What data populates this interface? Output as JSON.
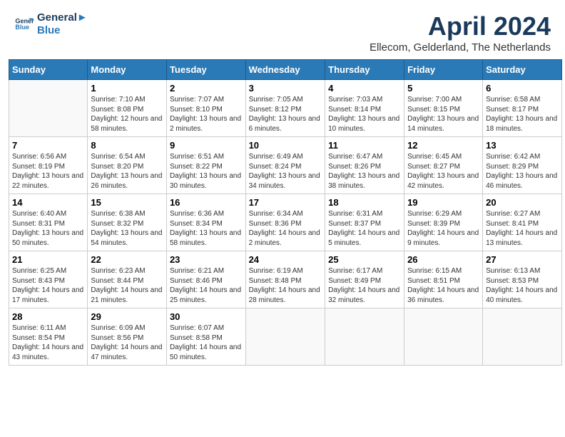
{
  "header": {
    "logo_line1": "General",
    "logo_line2": "Blue",
    "month_year": "April 2024",
    "location": "Ellecom, Gelderland, The Netherlands"
  },
  "days_of_week": [
    "Sunday",
    "Monday",
    "Tuesday",
    "Wednesday",
    "Thursday",
    "Friday",
    "Saturday"
  ],
  "weeks": [
    [
      {
        "day": "",
        "sunrise": "",
        "sunset": "",
        "daylight": ""
      },
      {
        "day": "1",
        "sunrise": "Sunrise: 7:10 AM",
        "sunset": "Sunset: 8:08 PM",
        "daylight": "Daylight: 12 hours and 58 minutes."
      },
      {
        "day": "2",
        "sunrise": "Sunrise: 7:07 AM",
        "sunset": "Sunset: 8:10 PM",
        "daylight": "Daylight: 13 hours and 2 minutes."
      },
      {
        "day": "3",
        "sunrise": "Sunrise: 7:05 AM",
        "sunset": "Sunset: 8:12 PM",
        "daylight": "Daylight: 13 hours and 6 minutes."
      },
      {
        "day": "4",
        "sunrise": "Sunrise: 7:03 AM",
        "sunset": "Sunset: 8:14 PM",
        "daylight": "Daylight: 13 hours and 10 minutes."
      },
      {
        "day": "5",
        "sunrise": "Sunrise: 7:00 AM",
        "sunset": "Sunset: 8:15 PM",
        "daylight": "Daylight: 13 hours and 14 minutes."
      },
      {
        "day": "6",
        "sunrise": "Sunrise: 6:58 AM",
        "sunset": "Sunset: 8:17 PM",
        "daylight": "Daylight: 13 hours and 18 minutes."
      }
    ],
    [
      {
        "day": "7",
        "sunrise": "Sunrise: 6:56 AM",
        "sunset": "Sunset: 8:19 PM",
        "daylight": "Daylight: 13 hours and 22 minutes."
      },
      {
        "day": "8",
        "sunrise": "Sunrise: 6:54 AM",
        "sunset": "Sunset: 8:20 PM",
        "daylight": "Daylight: 13 hours and 26 minutes."
      },
      {
        "day": "9",
        "sunrise": "Sunrise: 6:51 AM",
        "sunset": "Sunset: 8:22 PM",
        "daylight": "Daylight: 13 hours and 30 minutes."
      },
      {
        "day": "10",
        "sunrise": "Sunrise: 6:49 AM",
        "sunset": "Sunset: 8:24 PM",
        "daylight": "Daylight: 13 hours and 34 minutes."
      },
      {
        "day": "11",
        "sunrise": "Sunrise: 6:47 AM",
        "sunset": "Sunset: 8:26 PM",
        "daylight": "Daylight: 13 hours and 38 minutes."
      },
      {
        "day": "12",
        "sunrise": "Sunrise: 6:45 AM",
        "sunset": "Sunset: 8:27 PM",
        "daylight": "Daylight: 13 hours and 42 minutes."
      },
      {
        "day": "13",
        "sunrise": "Sunrise: 6:42 AM",
        "sunset": "Sunset: 8:29 PM",
        "daylight": "Daylight: 13 hours and 46 minutes."
      }
    ],
    [
      {
        "day": "14",
        "sunrise": "Sunrise: 6:40 AM",
        "sunset": "Sunset: 8:31 PM",
        "daylight": "Daylight: 13 hours and 50 minutes."
      },
      {
        "day": "15",
        "sunrise": "Sunrise: 6:38 AM",
        "sunset": "Sunset: 8:32 PM",
        "daylight": "Daylight: 13 hours and 54 minutes."
      },
      {
        "day": "16",
        "sunrise": "Sunrise: 6:36 AM",
        "sunset": "Sunset: 8:34 PM",
        "daylight": "Daylight: 13 hours and 58 minutes."
      },
      {
        "day": "17",
        "sunrise": "Sunrise: 6:34 AM",
        "sunset": "Sunset: 8:36 PM",
        "daylight": "Daylight: 14 hours and 2 minutes."
      },
      {
        "day": "18",
        "sunrise": "Sunrise: 6:31 AM",
        "sunset": "Sunset: 8:37 PM",
        "daylight": "Daylight: 14 hours and 5 minutes."
      },
      {
        "day": "19",
        "sunrise": "Sunrise: 6:29 AM",
        "sunset": "Sunset: 8:39 PM",
        "daylight": "Daylight: 14 hours and 9 minutes."
      },
      {
        "day": "20",
        "sunrise": "Sunrise: 6:27 AM",
        "sunset": "Sunset: 8:41 PM",
        "daylight": "Daylight: 14 hours and 13 minutes."
      }
    ],
    [
      {
        "day": "21",
        "sunrise": "Sunrise: 6:25 AM",
        "sunset": "Sunset: 8:43 PM",
        "daylight": "Daylight: 14 hours and 17 minutes."
      },
      {
        "day": "22",
        "sunrise": "Sunrise: 6:23 AM",
        "sunset": "Sunset: 8:44 PM",
        "daylight": "Daylight: 14 hours and 21 minutes."
      },
      {
        "day": "23",
        "sunrise": "Sunrise: 6:21 AM",
        "sunset": "Sunset: 8:46 PM",
        "daylight": "Daylight: 14 hours and 25 minutes."
      },
      {
        "day": "24",
        "sunrise": "Sunrise: 6:19 AM",
        "sunset": "Sunset: 8:48 PM",
        "daylight": "Daylight: 14 hours and 28 minutes."
      },
      {
        "day": "25",
        "sunrise": "Sunrise: 6:17 AM",
        "sunset": "Sunset: 8:49 PM",
        "daylight": "Daylight: 14 hours and 32 minutes."
      },
      {
        "day": "26",
        "sunrise": "Sunrise: 6:15 AM",
        "sunset": "Sunset: 8:51 PM",
        "daylight": "Daylight: 14 hours and 36 minutes."
      },
      {
        "day": "27",
        "sunrise": "Sunrise: 6:13 AM",
        "sunset": "Sunset: 8:53 PM",
        "daylight": "Daylight: 14 hours and 40 minutes."
      }
    ],
    [
      {
        "day": "28",
        "sunrise": "Sunrise: 6:11 AM",
        "sunset": "Sunset: 8:54 PM",
        "daylight": "Daylight: 14 hours and 43 minutes."
      },
      {
        "day": "29",
        "sunrise": "Sunrise: 6:09 AM",
        "sunset": "Sunset: 8:56 PM",
        "daylight": "Daylight: 14 hours and 47 minutes."
      },
      {
        "day": "30",
        "sunrise": "Sunrise: 6:07 AM",
        "sunset": "Sunset: 8:58 PM",
        "daylight": "Daylight: 14 hours and 50 minutes."
      },
      {
        "day": "",
        "sunrise": "",
        "sunset": "",
        "daylight": ""
      },
      {
        "day": "",
        "sunrise": "",
        "sunset": "",
        "daylight": ""
      },
      {
        "day": "",
        "sunrise": "",
        "sunset": "",
        "daylight": ""
      },
      {
        "day": "",
        "sunrise": "",
        "sunset": "",
        "daylight": ""
      }
    ]
  ]
}
